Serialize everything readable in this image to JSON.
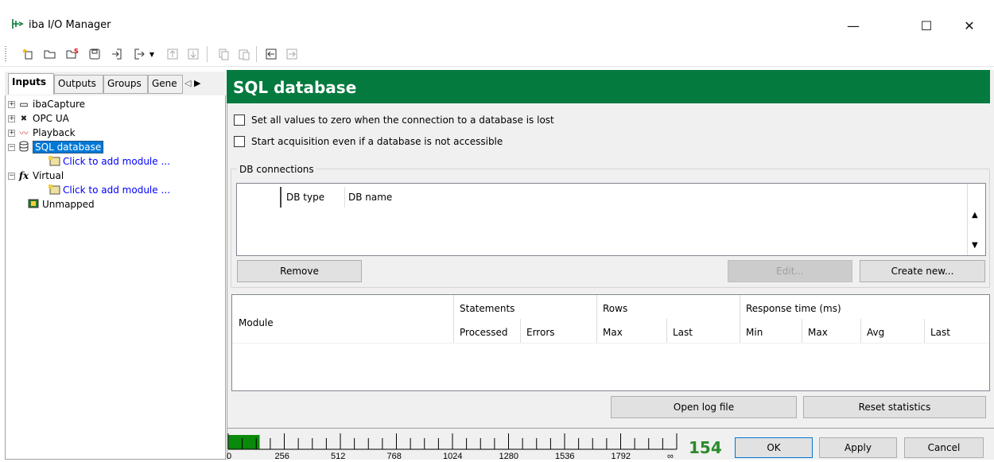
{
  "window": {
    "title": "iba I/O Manager",
    "minimize": "—",
    "maximize": "☐",
    "close": "✕"
  },
  "toolbar": {
    "icons": [
      "new-star-icon",
      "open-folder-icon",
      "open-save-icon",
      "save-icon",
      "import-icon",
      "export-icon",
      "move-up-icon",
      "move-down-icon",
      "copy-icon",
      "paste-icon",
      "collapse-left-icon",
      "expand-right-icon"
    ]
  },
  "tabs": [
    {
      "label": "Inputs"
    },
    {
      "label": "Outputs"
    },
    {
      "label": "Groups"
    },
    {
      "label": "Gene"
    }
  ],
  "tree": {
    "ibacapture": "ibaCapture",
    "opcua": "OPC UA",
    "playback": "Playback",
    "sqldb": "SQL database",
    "sql_add": "Click to add module ...",
    "virtual": "Virtual",
    "virtual_add": "Click to add module ...",
    "unmapped": "Unmapped"
  },
  "header": {
    "title": "SQL database"
  },
  "options": {
    "zero_on_loss": "Set all values to zero when the connection to a database is lost",
    "start_acq": "Start acquisition even if a database is not accessible"
  },
  "db": {
    "group_label": "DB connections",
    "col_type": "DB type",
    "col_name": "DB name",
    "remove": "Remove",
    "edit": "Edit...",
    "create": "Create new..."
  },
  "stats": {
    "module": "Module",
    "statements": "Statements",
    "rows": "Rows",
    "response": "Response time (ms)",
    "processed": "Processed",
    "errors": "Errors",
    "max": "Max",
    "last": "Last",
    "min": "Min",
    "rmax": "Max",
    "avg": "Avg",
    "rlast": "Last"
  },
  "log": {
    "open": "Open log file",
    "reset": "Reset statistics"
  },
  "scale": {
    "ticks": [
      "0",
      "256",
      "512",
      "768",
      "1024",
      "1280",
      "1536",
      "1792",
      "∞"
    ],
    "fill_fraction": 0.07
  },
  "signal_count": "154",
  "footer": {
    "ok": "OK",
    "apply": "Apply",
    "cancel": "Cancel"
  },
  "colors": {
    "header": "#057a3e",
    "count": "#2b8a2b",
    "selection": "#0078d7",
    "bar": "#0a8a0a"
  }
}
